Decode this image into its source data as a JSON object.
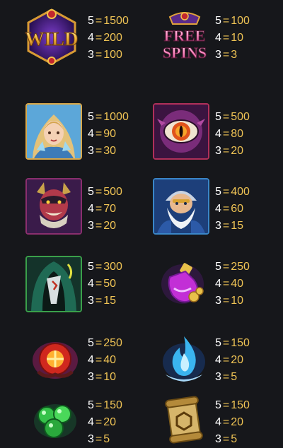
{
  "colors": {
    "background": "#16171b",
    "count": "#ffffff",
    "value": "#f0c455"
  },
  "symbols": [
    {
      "id": "wild",
      "icon": "wild-logo-icon",
      "text": "WILD",
      "payouts": [
        {
          "count": "5",
          "value": "1500"
        },
        {
          "count": "4",
          "value": "200"
        },
        {
          "count": "3",
          "value": "100"
        }
      ]
    },
    {
      "id": "free-spins",
      "icon": "free-spins-logo-icon",
      "text_line1": "FREE",
      "text_line2": "SPINS",
      "payouts": [
        {
          "count": "5",
          "value": "100"
        },
        {
          "count": "4",
          "value": "10"
        },
        {
          "count": "3",
          "value": "3"
        }
      ]
    },
    {
      "id": "elf-heroine",
      "icon": "elf-heroine-icon",
      "payouts": [
        {
          "count": "5",
          "value": "1000"
        },
        {
          "count": "4",
          "value": "90"
        },
        {
          "count": "3",
          "value": "30"
        }
      ]
    },
    {
      "id": "dragon-eye",
      "icon": "dragon-eye-icon",
      "payouts": [
        {
          "count": "5",
          "value": "500"
        },
        {
          "count": "4",
          "value": "80"
        },
        {
          "count": "3",
          "value": "20"
        }
      ]
    },
    {
      "id": "demon-warrior",
      "icon": "demon-warrior-icon",
      "payouts": [
        {
          "count": "5",
          "value": "500"
        },
        {
          "count": "4",
          "value": "70"
        },
        {
          "count": "3",
          "value": "20"
        }
      ]
    },
    {
      "id": "dwarf-wizard",
      "icon": "dwarf-wizard-icon",
      "payouts": [
        {
          "count": "5",
          "value": "400"
        },
        {
          "count": "4",
          "value": "60"
        },
        {
          "count": "3",
          "value": "15"
        }
      ]
    },
    {
      "id": "hooded-assassin",
      "icon": "hooded-assassin-icon",
      "payouts": [
        {
          "count": "5",
          "value": "300"
        },
        {
          "count": "4",
          "value": "50"
        },
        {
          "count": "3",
          "value": "15"
        }
      ]
    },
    {
      "id": "potion",
      "icon": "potion-icon",
      "payouts": [
        {
          "count": "5",
          "value": "250"
        },
        {
          "count": "4",
          "value": "40"
        },
        {
          "count": "3",
          "value": "10"
        }
      ]
    },
    {
      "id": "fire-orb",
      "icon": "fire-orb-icon",
      "payouts": [
        {
          "count": "5",
          "value": "250"
        },
        {
          "count": "4",
          "value": "40"
        },
        {
          "count": "3",
          "value": "10"
        }
      ]
    },
    {
      "id": "blue-flame",
      "icon": "blue-flame-icon",
      "payouts": [
        {
          "count": "5",
          "value": "150"
        },
        {
          "count": "4",
          "value": "20"
        },
        {
          "count": "3",
          "value": "5"
        }
      ]
    },
    {
      "id": "green-gems",
      "icon": "green-gems-icon",
      "payouts": [
        {
          "count": "5",
          "value": "150"
        },
        {
          "count": "4",
          "value": "20"
        },
        {
          "count": "3",
          "value": "5"
        }
      ]
    },
    {
      "id": "scroll",
      "icon": "scroll-icon",
      "payouts": [
        {
          "count": "5",
          "value": "150"
        },
        {
          "count": "4",
          "value": "20"
        },
        {
          "count": "3",
          "value": "5"
        }
      ]
    }
  ]
}
